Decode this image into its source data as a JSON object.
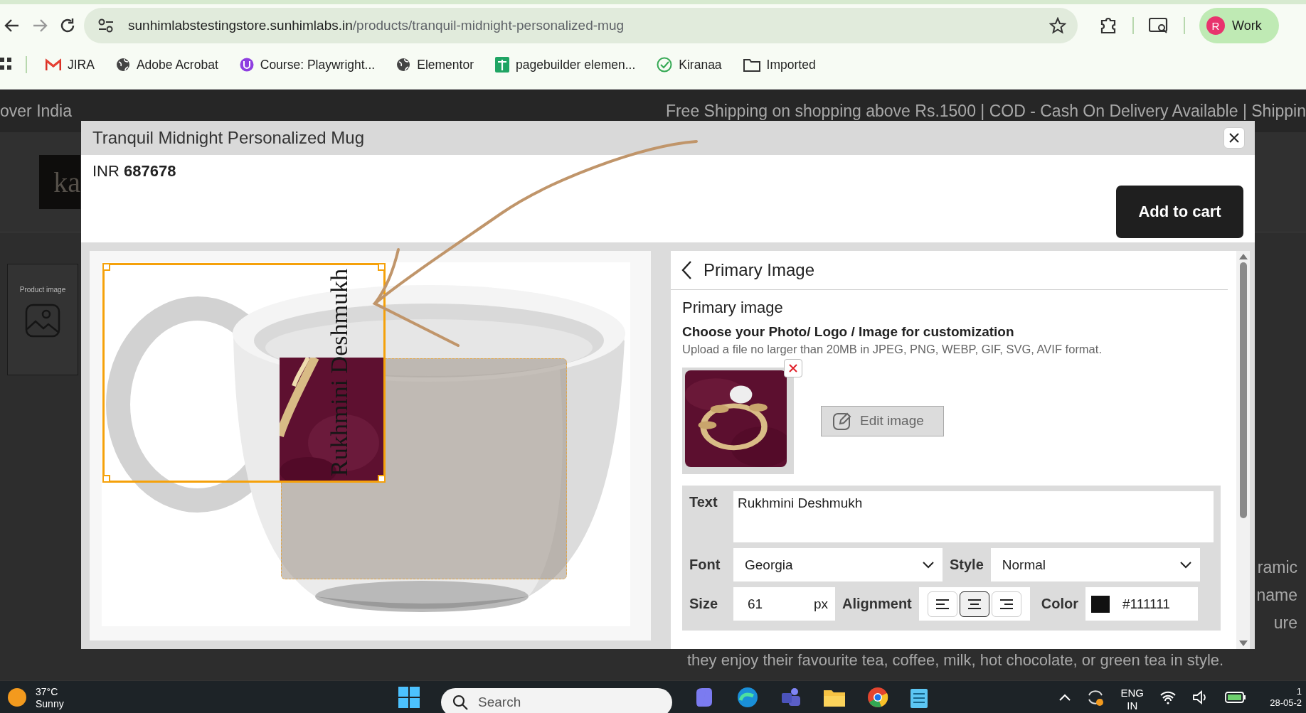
{
  "browser": {
    "url": {
      "host": "sunhimlabstestingstore.sunhimlabs.in",
      "path": "/products/tranquil-midnight-personalized-mug"
    },
    "profile": {
      "initial": "R",
      "label": "Work"
    },
    "bookmarks": [
      {
        "label": "JIRA",
        "kind": "mail"
      },
      {
        "label": "Adobe Acrobat",
        "kind": "globe"
      },
      {
        "label": "Course: Playwright...",
        "kind": "course"
      },
      {
        "label": "Elementor",
        "kind": "globe"
      },
      {
        "label": "pagebuilder elemen...",
        "kind": "sheet"
      },
      {
        "label": "Kiranaa",
        "kind": "check"
      },
      {
        "label": "Imported",
        "kind": "folder"
      }
    ]
  },
  "store": {
    "announcement_left": "over India",
    "announcement_right": "Free Shipping on shopping above Rs.1500 | COD - Cash On Delivery Available | Shippin",
    "logo": "ka",
    "thumbnail_label": "Product image",
    "description_fragments": [
      "ramic",
      "name",
      "ure"
    ],
    "description_last_line": "they enjoy their favourite tea, coffee, milk, hot chocolate, or green tea in style."
  },
  "modal": {
    "title": "Tranquil Midnight Personalized Mug",
    "currency": "INR",
    "price": "687678",
    "add_to_cart": "Add to cart",
    "canvas": {
      "overlay_text": "Rukhmini Deshmukh"
    },
    "panel": {
      "header": "Primary Image",
      "section_title": "Primary image",
      "prompt": "Choose your Photo/ Logo / Image for customization",
      "hint": "Upload a file no larger than 20MB in JPEG, PNG, WEBP, GIF, SVG, AVIF format.",
      "edit_button": {
        "label": "Edit image",
        "disabled": true
      },
      "text_field": {
        "label": "Text",
        "value": "Rukhmini Deshmukh"
      },
      "font": {
        "label": "Font",
        "value": "Georgia"
      },
      "style": {
        "label": "Style",
        "value": "Normal"
      },
      "size": {
        "label": "Size",
        "value": "61",
        "unit": "px"
      },
      "alignment": {
        "label": "Alignment",
        "options": [
          {
            "kind": "left",
            "selected": false
          },
          {
            "kind": "center",
            "selected": true
          },
          {
            "kind": "right",
            "selected": false
          }
        ]
      },
      "color": {
        "label": "Color",
        "value": "#111111"
      }
    }
  },
  "taskbar": {
    "weather": {
      "temperature": "37°C",
      "condition": "Sunny"
    },
    "search": {
      "placeholder": "Search"
    },
    "language": [
      "ENG",
      "IN"
    ],
    "clock": [
      "1",
      "28-05-2"
    ]
  }
}
